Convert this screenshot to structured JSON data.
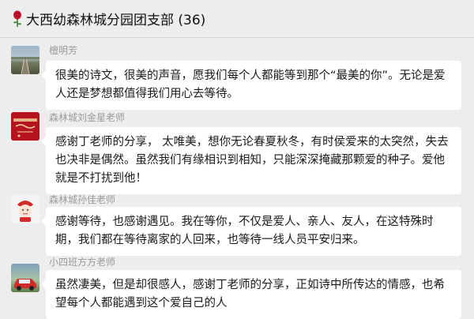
{
  "chat": {
    "title": "大西幼森林城分园团支部 (36)",
    "title_icon": "rose-icon"
  },
  "messages": [
    {
      "sender": "檀明芳",
      "avatar": "railway-photo-avatar",
      "text": "很美的诗文，很美的声音，愿我们每个人都能等到那个“最美的你”。无论是爱人还是梦想都值得我们用心去等待。"
    },
    {
      "sender": "森林城刘金星老师",
      "avatar": "red-calligraphy-avatar",
      "text": "感谢丁老师的分享， 太唯美，想你无论春夏秋冬，有时侯爱来的太突然，失去也决非是偶然。虽然我们有缘相识到相知，只能深深掩藏那颗爱的种子。爱他就是不打扰到他！"
    },
    {
      "sender": "森林城孙佳老师",
      "avatar": "cartoon-avatar",
      "text": "感谢等待，也感谢遇见。我在等你，不仅是爱人、亲人、友人，在这特殊时期，我们都在等待离家的人回来，也等待一线人员平安归来。"
    },
    {
      "sender": "小四班方方老师",
      "avatar": "car-photo-avatar",
      "text": "虽然凄美，但是却很感人，感谢丁老师的分享，正如诗中所传达的情感，也希望每个人都能遇到这个爱自己的人"
    }
  ]
}
